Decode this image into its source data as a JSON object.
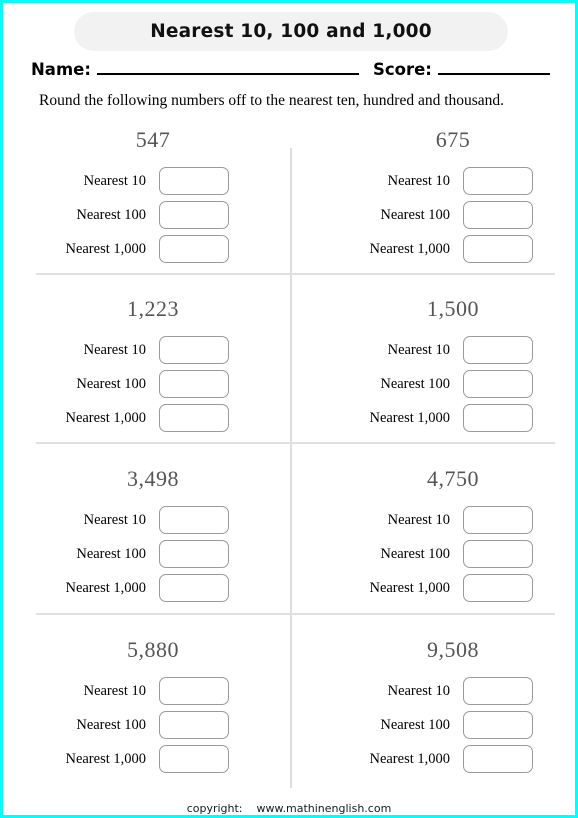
{
  "page": {
    "border_color": "#00ffff",
    "background": "#ffffff"
  },
  "header": {
    "title": "Nearest 10, 100 and 1,000",
    "title_pill_color": "#f2f2f2",
    "name_label": "Name:",
    "score_label": "Score:",
    "name_value": "",
    "score_value": "",
    "instruction": "Round the following numbers off to the nearest ten, hundred and thousand."
  },
  "answer_labels": {
    "ten": "Nearest 10",
    "hundred": "Nearest 100",
    "thousand": "Nearest 1,000"
  },
  "questions": [
    {
      "number": "547",
      "rows": [
        {
          "label": "Nearest 10",
          "value": ""
        },
        {
          "label": "Nearest 100",
          "value": ""
        },
        {
          "label": "Nearest 1,000",
          "value": ""
        }
      ]
    },
    {
      "number": "675",
      "rows": [
        {
          "label": "Nearest 10",
          "value": ""
        },
        {
          "label": "Nearest 100",
          "value": ""
        },
        {
          "label": "Nearest 1,000",
          "value": ""
        }
      ]
    },
    {
      "number": "1,223",
      "rows": [
        {
          "label": "Nearest 10",
          "value": ""
        },
        {
          "label": "Nearest 100",
          "value": ""
        },
        {
          "label": "Nearest 1,000",
          "value": ""
        }
      ]
    },
    {
      "number": "1,500",
      "rows": [
        {
          "label": "Nearest 10",
          "value": ""
        },
        {
          "label": "Nearest 100",
          "value": ""
        },
        {
          "label": "Nearest 1,000",
          "value": ""
        }
      ]
    },
    {
      "number": "3,498",
      "rows": [
        {
          "label": "Nearest 10",
          "value": ""
        },
        {
          "label": "Nearest 100",
          "value": ""
        },
        {
          "label": "Nearest 1,000",
          "value": ""
        }
      ]
    },
    {
      "number": "4,750",
      "rows": [
        {
          "label": "Nearest 10",
          "value": ""
        },
        {
          "label": "Nearest 100",
          "value": ""
        },
        {
          "label": "Nearest 1,000",
          "value": ""
        }
      ]
    },
    {
      "number": "5,880",
      "rows": [
        {
          "label": "Nearest 10",
          "value": ""
        },
        {
          "label": "Nearest 100",
          "value": ""
        },
        {
          "label": "Nearest 1,000",
          "value": ""
        }
      ]
    },
    {
      "number": "9,508",
      "rows": [
        {
          "label": "Nearest 10",
          "value": ""
        },
        {
          "label": "Nearest 100",
          "value": ""
        },
        {
          "label": "Nearest 1,000",
          "value": ""
        }
      ]
    }
  ],
  "footer": {
    "copyright_label": "copyright:",
    "site": "www.mathinenglish.com"
  }
}
